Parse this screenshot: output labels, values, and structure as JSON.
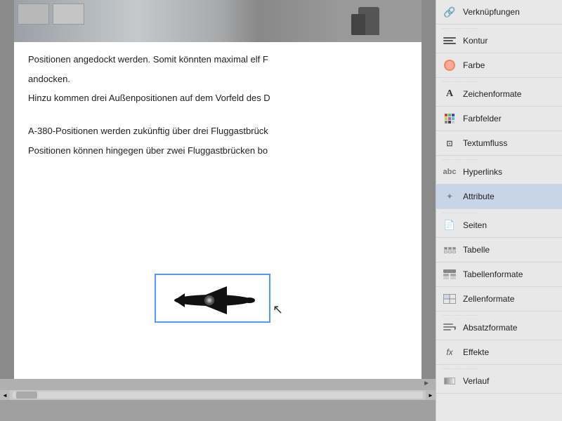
{
  "sidebar": {
    "items": [
      {
        "id": "verknuepfungen",
        "label": "Verknüpfungen",
        "icon": "chain-icon",
        "active": false
      },
      {
        "id": "kontur",
        "label": "Kontur",
        "icon": "kontur-icon",
        "active": false
      },
      {
        "id": "farbe",
        "label": "Farbe",
        "icon": "farbe-icon",
        "active": false
      },
      {
        "id": "zeichenformate",
        "label": "Zeichenformate",
        "icon": "zeichenformate-icon",
        "active": false
      },
      {
        "id": "farbfelder",
        "label": "Farbfelder",
        "icon": "farbfelder-icon",
        "active": false
      },
      {
        "id": "textumfluss",
        "label": "Textumfluss",
        "icon": "textumfluss-icon",
        "active": false
      },
      {
        "id": "hyperlinks",
        "label": "Hyperlinks",
        "icon": "hyperlinks-icon",
        "active": false
      },
      {
        "id": "attribute",
        "label": "Attribute",
        "icon": "attribute-icon",
        "active": true
      },
      {
        "id": "seiten",
        "label": "Seiten",
        "icon": "seiten-icon",
        "active": false
      },
      {
        "id": "tabelle",
        "label": "Tabelle",
        "icon": "tabelle-icon",
        "active": false
      },
      {
        "id": "tabellenformate",
        "label": "Tabellenformate",
        "icon": "tabellenformate-icon",
        "active": false
      },
      {
        "id": "zellenformate",
        "label": "Zellenformate",
        "icon": "zellenformate-icon",
        "active": false
      },
      {
        "id": "absatzformate",
        "label": "Absatzformate",
        "icon": "absatzformate-icon",
        "active": false
      },
      {
        "id": "effekte",
        "label": "Effekte",
        "icon": "effekte-icon",
        "active": false
      },
      {
        "id": "verlauf",
        "label": "Verlauf",
        "icon": "verlauf-icon",
        "active": false
      }
    ]
  },
  "document": {
    "text1": "Positionen angedockt werden. Somit könnten maximal elf F",
    "text2": "andocken.",
    "text3": "Hinzu kommen drei Außenpositionen auf dem Vorfeld des D",
    "text4": "A-380-Positionen werden zukünftig über drei Fluggastbrück",
    "text5": "Positionen können hingegen über zwei Fluggastbrücken bo"
  },
  "scrollbar": {
    "arrow_left": "◄",
    "arrow_right": "►",
    "page_arrow": "►"
  }
}
